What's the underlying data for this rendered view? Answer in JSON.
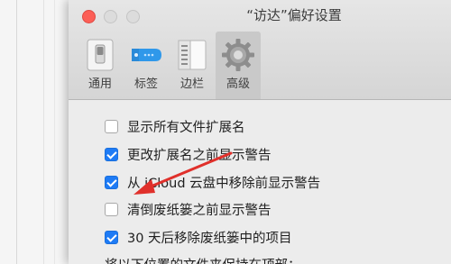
{
  "window": {
    "title": "“访达”偏好设置"
  },
  "tabs": [
    {
      "label": "通用",
      "icon": "switch-icon"
    },
    {
      "label": "标签",
      "icon": "tag-icon"
    },
    {
      "label": "边栏",
      "icon": "sidebar-icon"
    },
    {
      "label": "高级",
      "icon": "gear-icon",
      "selected": true
    }
  ],
  "options": [
    {
      "label": "显示所有文件扩展名",
      "checked": false
    },
    {
      "label": "更改扩展名之前显示警告",
      "checked": true
    },
    {
      "label": "从 iCloud 云盘中移除前显示警告",
      "checked": true
    },
    {
      "label": "清倒废纸篓之前显示警告",
      "checked": false
    },
    {
      "label": "30 天后移除废纸篓中的项目",
      "checked": true
    }
  ],
  "partial_line": "将以下位置的文件夹保持在顶部：",
  "colors": {
    "accent": "#1e7bf5",
    "annotation_arrow": "#e0302b"
  }
}
